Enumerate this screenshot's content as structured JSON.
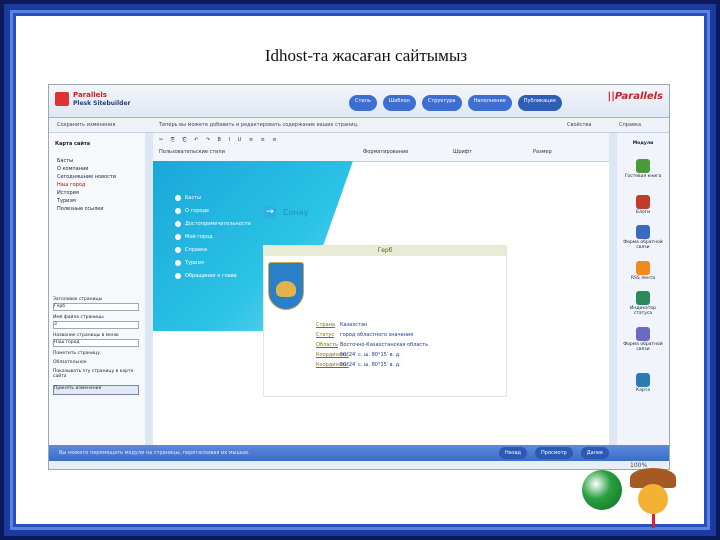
{
  "slide": {
    "title": "Idhost-та жасаған сайтымыз"
  },
  "app": {
    "logo_line1": "Parallels",
    "logo_line2": "Plesk Sitebuilder",
    "brand": "||Parallels",
    "steps": [
      "Стиль",
      "Шаблон",
      "Структура",
      "Наполнение",
      "Публикация"
    ],
    "toolbar_left": "Сохранить изменения",
    "toolbar_hint": "Теперь вы можете добавить и редактировать содержание ваших страниц.",
    "toolbar_right": [
      "Свойства",
      "Справка"
    ]
  },
  "left_panel": {
    "title": "Карта сайта",
    "tree": [
      "Басты",
      "О компании",
      "Сегодняшние новости",
      "Наш город",
      "История",
      "Туризм",
      "Полезные ссылки"
    ],
    "selected_index": 3,
    "props": {
      "label1": "Заголовок страницы",
      "value1": "Герб",
      "label2": "Имя файла страницы",
      "value2": "3",
      "label3": "Название страницы в меню",
      "value3": "Наш город",
      "label4": "Пометить страницу",
      "check1": "Обязательное",
      "check2": "Показывать эту страницу в карте сайта",
      "button": "Принять изменения"
    }
  },
  "editor": {
    "tool_font": "Пользовательские стили",
    "tool_format": "Форматирование",
    "tool_fontname": "Шрифт",
    "tool_size": "Размер",
    "site_nav": [
      "Басты",
      "О городе",
      "Достопримечательности",
      "Мой город",
      "Справка",
      "Туризм",
      "Обращение к главе"
    ],
    "page_heading": "Сонау",
    "gerb_title": "Герб",
    "info_rows": [
      {
        "k": "Страна",
        "v": "Казахстан"
      },
      {
        "k": "Статус",
        "v": "город областного значения"
      },
      {
        "k": "Область",
        "v": "Восточно-Казахстанская область"
      },
      {
        "k": "Координаты",
        "v": "50°24′ с. ш. 80°15′ в. д."
      },
      {
        "k": "Координаты",
        "v": "50°24′ с. ш. 80°15′ в. д."
      }
    ]
  },
  "right_panel": {
    "title": "Модули",
    "items": [
      "Гостевая книга",
      "Блоги",
      "Форма обратной связи",
      "RSS лента",
      "Индикатор статуса",
      "Форма обратной связи",
      "Карта"
    ]
  },
  "bottom": {
    "status_text": "Вы можете перемещать модули на страницы, перетаскивая их мышью.",
    "buttons": [
      "Назад",
      "Просмотр",
      "Далее"
    ],
    "zoom": "100%"
  }
}
